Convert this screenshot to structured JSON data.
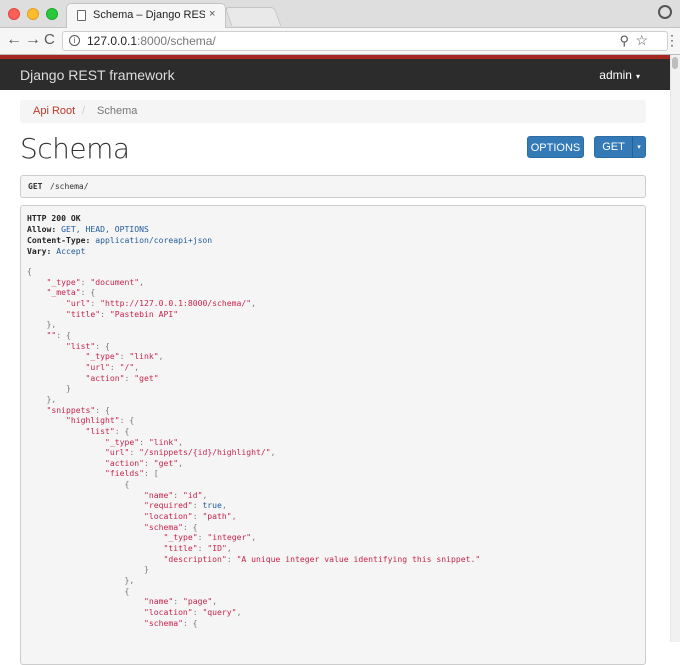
{
  "browser": {
    "tab_title": "Schema – Django REST framew",
    "tab_close": "×",
    "url_host": "127.0.0.1",
    "url_rest": ":8000/schema/",
    "nav_back": "←",
    "nav_forward": "→",
    "nav_reload": "C",
    "info": "i",
    "zoom": "⚲",
    "star": "☆",
    "menu": "⋮"
  },
  "navbar": {
    "brand": "Django REST framework",
    "user": "admin",
    "user_caret": "▾"
  },
  "breadcrumb": {
    "root": "Api Root",
    "separator": "/",
    "current": "Schema"
  },
  "page": {
    "title": "Schema",
    "options_label": "OPTIONS",
    "get_label": "GET",
    "get_caret": "▾"
  },
  "request": {
    "method": "GET",
    "path": "/schema/"
  },
  "response": {
    "status": "HTTP 200 OK",
    "headers": [
      {
        "name": "Allow:",
        "value": "GET, HEAD, OPTIONS"
      },
      {
        "name": "Content-Type:",
        "value": "application/coreapi+json"
      },
      {
        "name": "Vary:",
        "value": "Accept"
      }
    ],
    "body_lines": [
      {
        "indent": 0,
        "parts": [
          [
            "p",
            "{"
          ]
        ]
      },
      {
        "indent": 1,
        "parts": [
          [
            "k",
            "\"_type\""
          ],
          [
            "p",
            ": "
          ],
          [
            "s",
            "\"document\""
          ],
          [
            "p",
            ","
          ]
        ]
      },
      {
        "indent": 1,
        "parts": [
          [
            "k",
            "\"_meta\""
          ],
          [
            "p",
            ": {"
          ]
        ]
      },
      {
        "indent": 2,
        "parts": [
          [
            "k",
            "\"url\""
          ],
          [
            "p",
            ": "
          ],
          [
            "s",
            "\"http://127.0.0.1:8000/schema/\""
          ],
          [
            "p",
            ","
          ]
        ]
      },
      {
        "indent": 2,
        "parts": [
          [
            "k",
            "\"title\""
          ],
          [
            "p",
            ": "
          ],
          [
            "s",
            "\"Pastebin API\""
          ]
        ]
      },
      {
        "indent": 1,
        "parts": [
          [
            "p",
            "},"
          ]
        ]
      },
      {
        "indent": 1,
        "parts": [
          [
            "k",
            "\"\""
          ],
          [
            "p",
            ": {"
          ]
        ]
      },
      {
        "indent": 2,
        "parts": [
          [
            "k",
            "\"list\""
          ],
          [
            "p",
            ": {"
          ]
        ]
      },
      {
        "indent": 3,
        "parts": [
          [
            "k",
            "\"_type\""
          ],
          [
            "p",
            ": "
          ],
          [
            "s",
            "\"link\""
          ],
          [
            "p",
            ","
          ]
        ]
      },
      {
        "indent": 3,
        "parts": [
          [
            "k",
            "\"url\""
          ],
          [
            "p",
            ": "
          ],
          [
            "s",
            "\"/\""
          ],
          [
            "p",
            ","
          ]
        ]
      },
      {
        "indent": 3,
        "parts": [
          [
            "k",
            "\"action\""
          ],
          [
            "p",
            ": "
          ],
          [
            "s",
            "\"get\""
          ]
        ]
      },
      {
        "indent": 2,
        "parts": [
          [
            "p",
            "}"
          ]
        ]
      },
      {
        "indent": 1,
        "parts": [
          [
            "p",
            "},"
          ]
        ]
      },
      {
        "indent": 1,
        "parts": [
          [
            "k",
            "\"snippets\""
          ],
          [
            "p",
            ": {"
          ]
        ]
      },
      {
        "indent": 2,
        "parts": [
          [
            "k",
            "\"highlight\""
          ],
          [
            "p",
            ": {"
          ]
        ]
      },
      {
        "indent": 3,
        "parts": [
          [
            "k",
            "\"list\""
          ],
          [
            "p",
            ": {"
          ]
        ]
      },
      {
        "indent": 4,
        "parts": [
          [
            "k",
            "\"_type\""
          ],
          [
            "p",
            ": "
          ],
          [
            "s",
            "\"link\""
          ],
          [
            "p",
            ","
          ]
        ]
      },
      {
        "indent": 4,
        "parts": [
          [
            "k",
            "\"url\""
          ],
          [
            "p",
            ": "
          ],
          [
            "s",
            "\"/snippets/{id}/highlight/\""
          ],
          [
            "p",
            ","
          ]
        ]
      },
      {
        "indent": 4,
        "parts": [
          [
            "k",
            "\"action\""
          ],
          [
            "p",
            ": "
          ],
          [
            "s",
            "\"get\""
          ],
          [
            "p",
            ","
          ]
        ]
      },
      {
        "indent": 4,
        "parts": [
          [
            "k",
            "\"fields\""
          ],
          [
            "p",
            ": ["
          ]
        ]
      },
      {
        "indent": 5,
        "parts": [
          [
            "p",
            "{"
          ]
        ]
      },
      {
        "indent": 6,
        "parts": [
          [
            "k",
            "\"name\""
          ],
          [
            "p",
            ": "
          ],
          [
            "s",
            "\"id\""
          ],
          [
            "p",
            ","
          ]
        ]
      },
      {
        "indent": 6,
        "parts": [
          [
            "k",
            "\"required\""
          ],
          [
            "p",
            ": "
          ],
          [
            "b",
            "true"
          ],
          [
            "p",
            ","
          ]
        ]
      },
      {
        "indent": 6,
        "parts": [
          [
            "k",
            "\"location\""
          ],
          [
            "p",
            ": "
          ],
          [
            "s",
            "\"path\""
          ],
          [
            "p",
            ","
          ]
        ]
      },
      {
        "indent": 6,
        "parts": [
          [
            "k",
            "\"schema\""
          ],
          [
            "p",
            ": {"
          ]
        ]
      },
      {
        "indent": 7,
        "parts": [
          [
            "k",
            "\"_type\""
          ],
          [
            "p",
            ": "
          ],
          [
            "s",
            "\"integer\""
          ],
          [
            "p",
            ","
          ]
        ]
      },
      {
        "indent": 7,
        "parts": [
          [
            "k",
            "\"title\""
          ],
          [
            "p",
            ": "
          ],
          [
            "s",
            "\"ID\""
          ],
          [
            "p",
            ","
          ]
        ]
      },
      {
        "indent": 7,
        "parts": [
          [
            "k",
            "\"description\""
          ],
          [
            "p",
            ": "
          ],
          [
            "s",
            "\"A unique integer value identifying this snippet.\""
          ]
        ]
      },
      {
        "indent": 6,
        "parts": [
          [
            "p",
            "}"
          ]
        ]
      },
      {
        "indent": 5,
        "parts": [
          [
            "p",
            "},"
          ]
        ]
      },
      {
        "indent": 5,
        "parts": [
          [
            "p",
            "{"
          ]
        ]
      },
      {
        "indent": 6,
        "parts": [
          [
            "k",
            "\"name\""
          ],
          [
            "p",
            ": "
          ],
          [
            "s",
            "\"page\""
          ],
          [
            "p",
            ","
          ]
        ]
      },
      {
        "indent": 6,
        "parts": [
          [
            "k",
            "\"location\""
          ],
          [
            "p",
            ": "
          ],
          [
            "s",
            "\"query\""
          ],
          [
            "p",
            ","
          ]
        ]
      },
      {
        "indent": 6,
        "parts": [
          [
            "k",
            "\"schema\""
          ],
          [
            "p",
            ": {"
          ]
        ]
      }
    ]
  }
}
